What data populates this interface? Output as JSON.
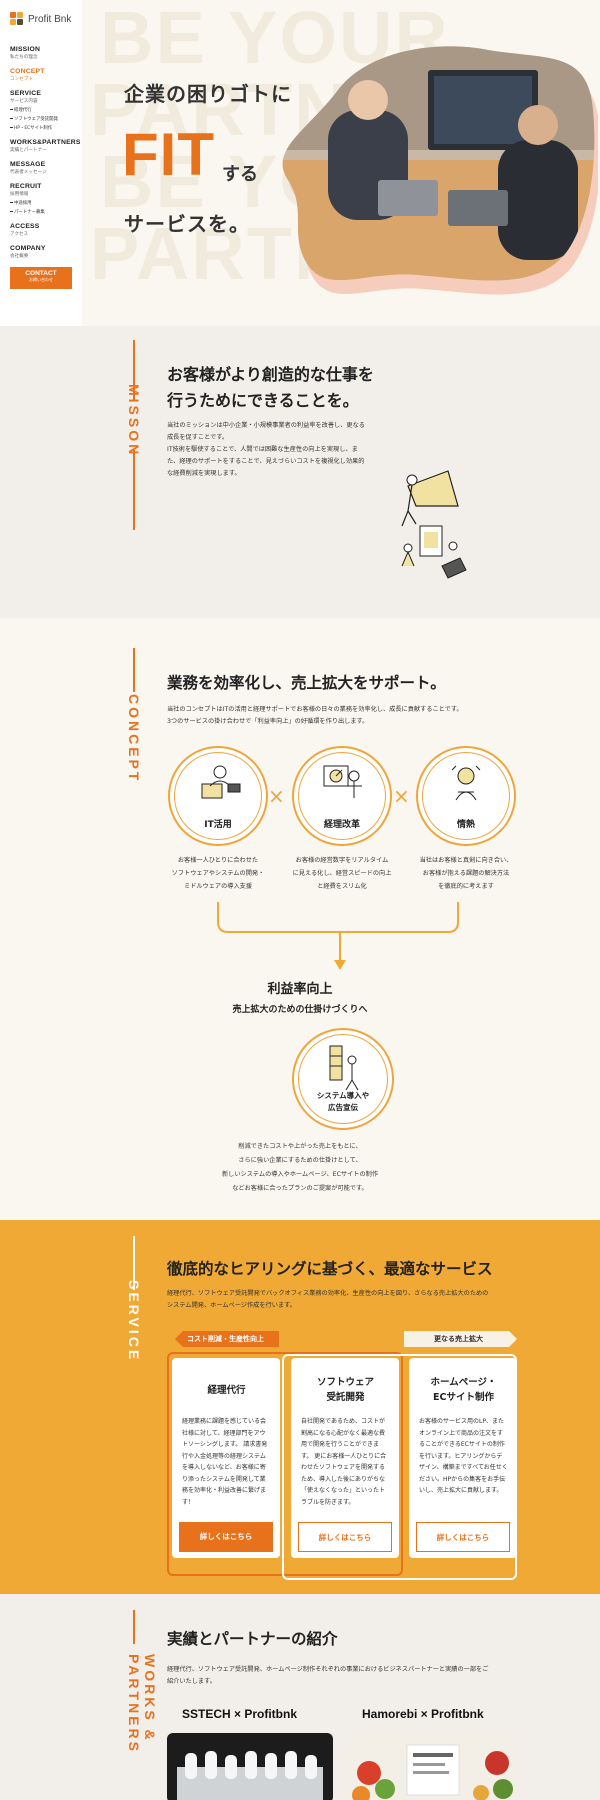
{
  "sidebar": {
    "logo_text": "Profit Bnk",
    "logo_sub": "",
    "nav": [
      {
        "en": "MISSION",
        "ja": "私たちの理念",
        "active": false,
        "subs": []
      },
      {
        "en": "CONCEPT",
        "ja": "コンセプト",
        "active": true,
        "subs": []
      },
      {
        "en": "SERVICE",
        "ja": "サービス内容",
        "active": false,
        "subs": [
          "経理代行",
          "ソフトウェア受託開発",
          "HP・ECサイト制作"
        ]
      },
      {
        "en": "WORKS&PARTNERS",
        "ja": "実績とパートナー",
        "active": false,
        "subs": []
      },
      {
        "en": "MESSAGE",
        "ja": "代表者メッセージ",
        "active": false,
        "subs": []
      },
      {
        "en": "RECRUIT",
        "ja": "採用情報",
        "active": false,
        "subs": [
          "中途採用",
          "パートナー募集"
        ]
      },
      {
        "en": "ACCESS",
        "ja": "アクセス",
        "active": false,
        "subs": []
      },
      {
        "en": "COMPANY",
        "ja": "会社概要",
        "active": false,
        "subs": []
      }
    ],
    "contact_en": "CONTACT",
    "contact_ja": "お問い合わせ"
  },
  "hero": {
    "bg_text_lines": [
      "BE YOUR",
      "PARTNER",
      "BE YOUR",
      "PARTNER"
    ],
    "line1": "企業の困りゴトに",
    "fit": "FIT",
    "suru": "する",
    "line3": "サービスを。"
  },
  "mission": {
    "label": "MISSON",
    "title_1": "お客様がより創造的な仕事を",
    "title_2": "行うためにできることを。",
    "text": [
      "当社のミッションは中小企業・小規模事業者の利益率を改善し、更なる",
      "成長を促すことです。",
      "IT技術を駆使することで、人間では困難な生産性の向上を実現し、ま",
      "た、経理のサポートをすることで、見えづらいコストを複視化し効果的",
      "な経費削減を実現します。"
    ]
  },
  "concept": {
    "label": "CONCEPT",
    "title": "業務を効率化し、売上拡大をサポート。",
    "text": [
      "当社のコンセプトはITの活用と経理サポートでお客様の日々の業務を効率化し、成長に貢献することです。",
      "3つのサービスの掛け合わせで「利益率向上」の好循環を作り出します。"
    ],
    "circles": [
      {
        "label": "IT活用",
        "desc": [
          "お客様一人ひとりに合わせた",
          "ソフトウェアやシステムの開発・",
          "ミドルウェアの導入支援"
        ]
      },
      {
        "label": "経理改革",
        "desc": [
          "お客様の経営数字をリアルタイム",
          "に見える化し、経営スピードの向上",
          "と経費をスリム化"
        ]
      },
      {
        "label": "情熱",
        "desc": [
          "当社はお客様と真剣に向き合い、",
          "お客様が抱える課題の解決方法",
          "を徹底的に考えます"
        ]
      }
    ],
    "times": "×",
    "result_title": "利益率向上",
    "result_sub": "売上拡大のための仕掛けづくりへ",
    "result_circle": [
      "システム導入や",
      "広告宣伝"
    ],
    "result_text": [
      "削減できたコストや上がった売上をもとに、",
      "さらに強い企業にするための仕掛けとして、",
      "新しいシステムの導入やホームページ、ECサイトの制作",
      "などお客様に合ったプランのご提案が可能です。"
    ]
  },
  "service": {
    "label": "SERVICE",
    "title": "徹底的なヒアリングに基づく、最適なサービス",
    "text": [
      "経理代行、ソフトウェア受託開発でバックオフィス業務の効率化、生産性の向上を図り、さらなる売上拡大のための",
      "システム開発、ホームページ作成を行います。"
    ],
    "tag_left": "コスト削減・生産性向上",
    "tag_right": "更なる売上拡大",
    "cards": [
      {
        "title": "経理代行",
        "body": "経理業務に課題を感じている会社様に対して、経理部門をアウトソーシングします。 請求書発行や入金処理等の経理システムを導入しないなど、お客様に寄り添ったシステムを開発して業務を効率化・利益改善に繋げます！",
        "button": "詳しくはこちら"
      },
      {
        "title": "ソフトウェア\n受託開発",
        "body": "自社開発であるため、コストが割高になる心配がなく最適な費用で開発を行うことができます。 更にお客様一人ひとりに合わせたソフトウェアを開発するため、導入した後にありがちな「使えなくなった」といったトラブルを防ぎます。",
        "button": "詳しくはこちら"
      },
      {
        "title": "ホームページ・\nECサイト制作",
        "body": "お客様のサービス用のLP、またオンライン上で商品の注文をすることができるECサイトの制作を行います。ヒアリングからデザイン、構築まですべてお任せください。HPからの集客をお手伝いし、売上拡大に貢献します。",
        "button": "詳しくはこちら"
      }
    ]
  },
  "works": {
    "label": "WORKS & PARTNERS",
    "title": "実績とパートナーの紹介",
    "text": [
      "経理代行、ソフトウェア受託開発、ホームページ制作それぞれの事業におけるビジネスパートナーと実績の一部をご",
      "紹介いたします。"
    ],
    "partners": [
      {
        "name": "SSTECH × Profitbnk"
      },
      {
        "name": "Hamorebi × Profitbnk"
      }
    ]
  },
  "colors": {
    "accent": "#e8711c",
    "yellow": "#f0a935",
    "cream": "#faf7f1"
  }
}
